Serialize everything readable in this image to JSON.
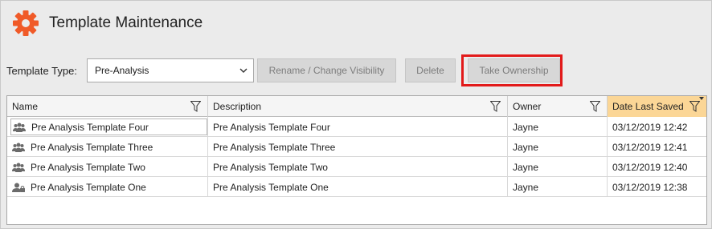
{
  "window": {
    "title": "Template Maintenance"
  },
  "toolbar": {
    "template_type_label": "Template Type:",
    "template_type_value": "Pre-Analysis",
    "rename_label": "Rename / Change Visibility",
    "delete_label": "Delete",
    "take_ownership_label": "Take Ownership"
  },
  "grid": {
    "columns": [
      "Name",
      "Description",
      "Owner",
      "Date Last Saved"
    ],
    "sorted_column": "Date Last Saved",
    "rows": [
      {
        "name": "Pre Analysis Template Four",
        "description": "Pre Analysis Template Four",
        "owner": "Jayne",
        "date": "03/12/2019 12:42",
        "icon": "group-icon"
      },
      {
        "name": "Pre Analysis Template Three",
        "description": "Pre Analysis Template Three",
        "owner": "Jayne",
        "date": "03/12/2019 12:41",
        "icon": "group-icon"
      },
      {
        "name": "Pre Analysis Template Two",
        "description": "Pre Analysis Template Two",
        "owner": "Jayne",
        "date": "03/12/2019 12:40",
        "icon": "group-icon"
      },
      {
        "name": "Pre Analysis Template One",
        "description": "Pre Analysis Template One",
        "owner": "Jayne",
        "date": "03/12/2019 12:38",
        "icon": "private-user-icon"
      }
    ]
  },
  "colors": {
    "accent": "#f05a28",
    "highlight": "#e21a1a",
    "sorted_header": "#fbd696"
  }
}
